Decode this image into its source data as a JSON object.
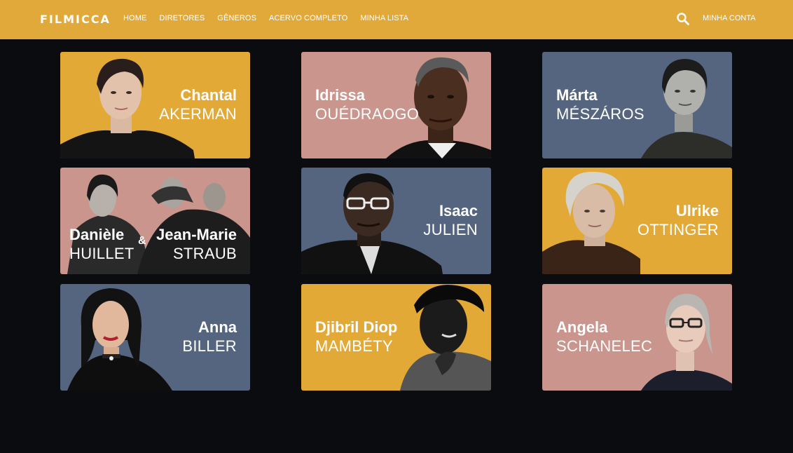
{
  "header": {
    "logo": "FILMICCA",
    "nav": [
      "HOME",
      "DIRETORES",
      "GÊNEROS",
      "ACERVO COMPLETO",
      "MINHA LISTA"
    ],
    "account": "MINHA CONTA",
    "search_icon": "search-icon"
  },
  "colors": {
    "accent": "#e0a93a",
    "background": "#0b0c10",
    "card_yellow": "#e3a937",
    "card_pink": "#c9958c",
    "card_slate": "#55657f"
  },
  "directors": [
    {
      "first": "Chantal",
      "last": "AKERMAN",
      "color": "yellow"
    },
    {
      "first": "Idrissa",
      "last": "OUÉDRAOGO",
      "color": "pink"
    },
    {
      "first": "Márta",
      "last": "MÉSZÁROS",
      "color": "slate"
    },
    {
      "first": "Danièle",
      "last": "HUILLET",
      "first2": "Jean-Marie",
      "last2": "STRAUB",
      "amp": "&",
      "color": "pink"
    },
    {
      "first": "Isaac",
      "last": "JULIEN",
      "color": "slate"
    },
    {
      "first": "Ulrike",
      "last": "OTTINGER",
      "color": "yellow"
    },
    {
      "first": "Anna",
      "last": "BILLER",
      "color": "slate"
    },
    {
      "first": "Djibril Diop",
      "last": "MAMBÉTY",
      "color": "yellow"
    },
    {
      "first": "Angela",
      "last": "SCHANELEC",
      "color": "pink"
    }
  ]
}
